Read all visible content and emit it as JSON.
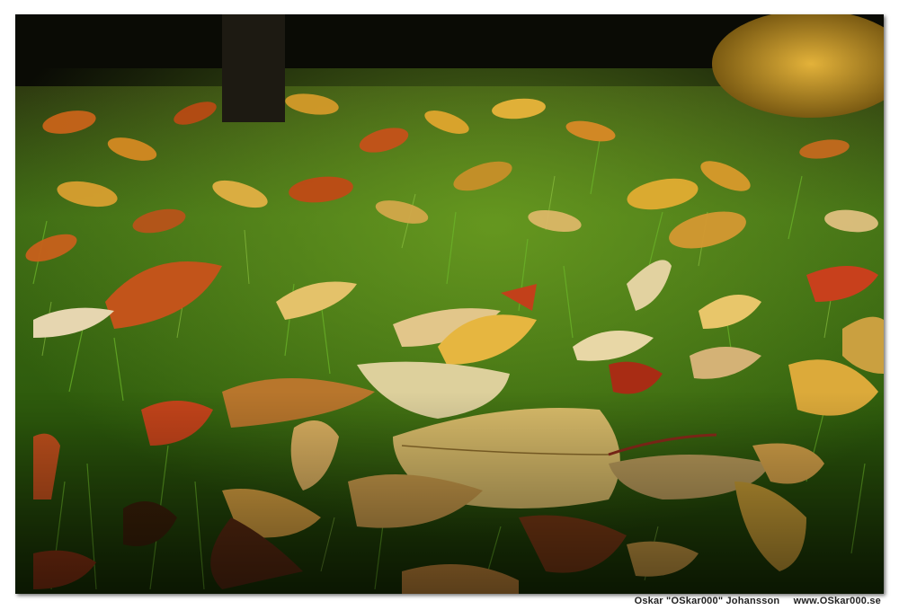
{
  "photo": {
    "credit_author": "Oskar \"OSkar000\" Johansson",
    "credit_site": "www.OSkar000.se"
  }
}
